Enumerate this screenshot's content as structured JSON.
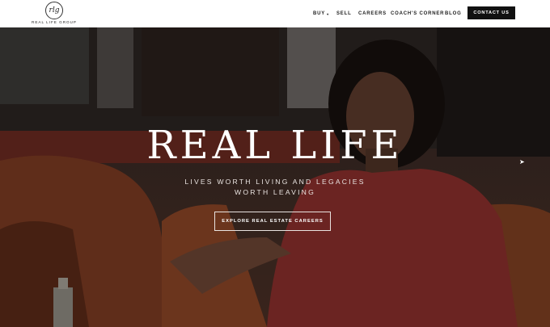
{
  "brand": {
    "logo_mark": "rlg",
    "logo_text": "REAL LIFE GROUP"
  },
  "nav": {
    "items": [
      {
        "label": "BUY",
        "has_dropdown": true
      },
      {
        "label": "SELL"
      },
      {
        "label": "CAREERS"
      },
      {
        "label": "COACH'S CORNER"
      },
      {
        "label": "BLOG"
      }
    ],
    "dropdown_caret": "▾",
    "contact_label": "CONTACT US"
  },
  "hero": {
    "title": "REAL LIFE",
    "subtitle": "LIVES WORTH LIVING AND LEGACIES WORTH LEAVING",
    "cta_label": "EXPLORE REAL ESTATE CAREERS"
  },
  "colors": {
    "header_bg": "#ffffff",
    "button_bg": "#111111",
    "text_light": "#ffffff"
  },
  "icons": {
    "cursor": "mouse-pointer-icon"
  }
}
